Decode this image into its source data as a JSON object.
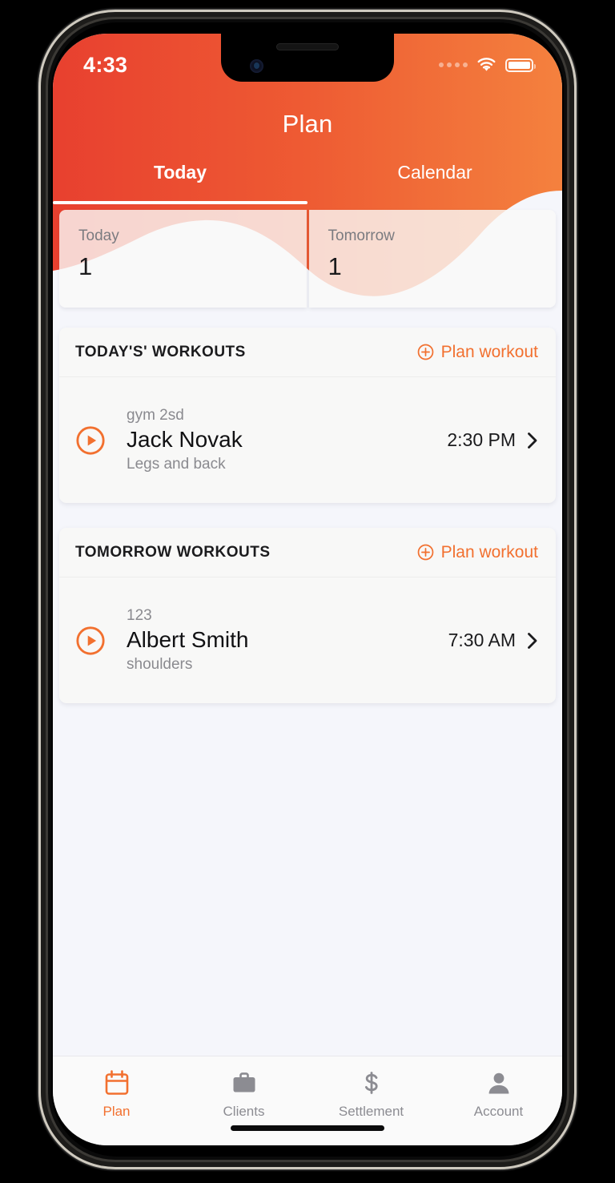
{
  "theme": {
    "accent": "#F2702F",
    "header_gradient_from": "#E8402F",
    "header_gradient_to": "#F4813E",
    "page_bg": "#F5F6FB",
    "card_bg": "#F8F8F7",
    "muted_text": "#8A8A8F"
  },
  "status_bar": {
    "time": "4:33",
    "signal_icon": "signal-dots-icon",
    "wifi_icon": "wifi-icon",
    "battery_icon": "battery-full-icon"
  },
  "header": {
    "title": "Plan",
    "tabs": [
      {
        "label": "Today",
        "active": true
      },
      {
        "label": "Calendar",
        "active": false
      }
    ]
  },
  "stats": [
    {
      "label": "Today",
      "value": "1"
    },
    {
      "label": "Tomorrow",
      "value": "1"
    }
  ],
  "sections": [
    {
      "title": "TODAY'S' WORKOUTS",
      "action_label": "Plan workout",
      "action_icon": "plus-circle-icon",
      "workouts": [
        {
          "gym": "gym 2sd",
          "name": "Jack Novak",
          "description": "Legs and back",
          "time": "2:30 PM",
          "play_icon": "play-circle-icon",
          "chevron_icon": "chevron-right-icon"
        }
      ]
    },
    {
      "title": "TOMORROW WORKOUTS",
      "action_label": "Plan workout",
      "action_icon": "plus-circle-icon",
      "workouts": [
        {
          "gym": "123",
          "name": "Albert Smith",
          "description": "shoulders",
          "time": "7:30 AM",
          "play_icon": "play-circle-icon",
          "chevron_icon": "chevron-right-icon"
        }
      ]
    }
  ],
  "tabbar": [
    {
      "label": "Plan",
      "icon": "calendar-icon",
      "active": true
    },
    {
      "label": "Clients",
      "icon": "briefcase-icon",
      "active": false
    },
    {
      "label": "Settlement",
      "icon": "dollar-icon",
      "active": false
    },
    {
      "label": "Account",
      "icon": "person-icon",
      "active": false
    }
  ]
}
